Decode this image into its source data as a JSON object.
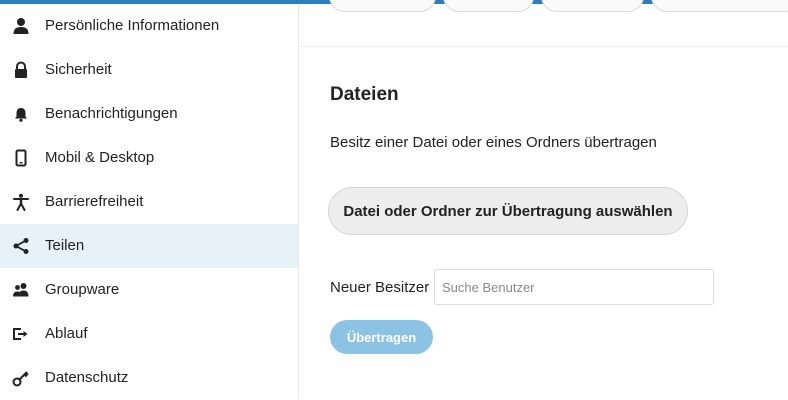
{
  "sidebar": {
    "items": [
      {
        "label": "Persönliche Informationen",
        "icon": "user-icon",
        "active": false
      },
      {
        "label": "Sicherheit",
        "icon": "lock-icon",
        "active": false
      },
      {
        "label": "Benachrichtigungen",
        "icon": "bell-icon",
        "active": false
      },
      {
        "label": "Mobil & Desktop",
        "icon": "phone-icon",
        "active": false
      },
      {
        "label": "Barrierefreiheit",
        "icon": "accessibility-icon",
        "active": false
      },
      {
        "label": "Teilen",
        "icon": "share-icon",
        "active": true
      },
      {
        "label": "Groupware",
        "icon": "group-icon",
        "active": false
      },
      {
        "label": "Ablauf",
        "icon": "workflow-icon",
        "active": false
      },
      {
        "label": "Datenschutz",
        "icon": "key-icon",
        "active": false
      }
    ]
  },
  "main": {
    "section_title": "Dateien",
    "description": "Besitz einer Datei oder eines Ordners übertragen",
    "choose_button_label": "Datei oder Ordner zur Übertragung auswählen",
    "new_owner_label": "Neuer Besitzer",
    "search_placeholder": "Suche Benutzer",
    "search_value": "",
    "transfer_button_label": "Übertragen"
  },
  "colors": {
    "accent": "#2c7fbf",
    "active_item_bg": "#e6f1f8",
    "transfer_button_bg": "#8cc3e4"
  }
}
